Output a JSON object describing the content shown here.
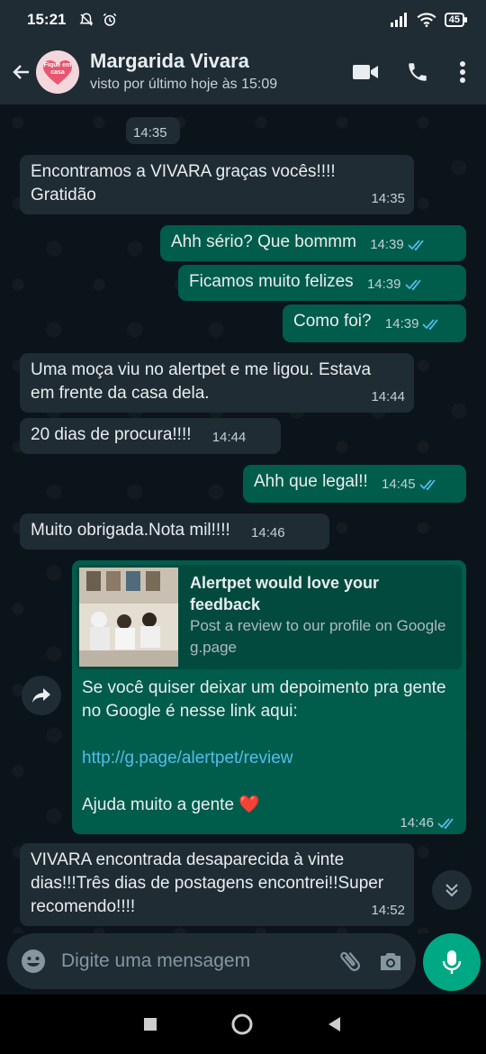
{
  "status_bar": {
    "time": "15:21",
    "battery": "45"
  },
  "header": {
    "contact_name": "Margarida Vivara",
    "last_seen": "visto por último hoje às 15:09",
    "avatar_text": "Fique em casa"
  },
  "messages": [
    {
      "type": "in",
      "text": "",
      "time": "14:35"
    },
    {
      "type": "in",
      "text": "Encontramos   a VIVARA  graças vocês!!!! Gratidão",
      "time": "14:35"
    },
    {
      "type": "out",
      "text": "Ahh sério? Que bommm",
      "time": "14:39"
    },
    {
      "type": "out",
      "text": "Ficamos muito felizes",
      "time": "14:39"
    },
    {
      "type": "out",
      "text": "Como foi?",
      "time": "14:39"
    },
    {
      "type": "in",
      "text": "Uma moça  viu no alertpet  e me ligou. Estava em frente da casa dela.",
      "time": "14:44"
    },
    {
      "type": "in",
      "text": "20 dias de procura!!!!",
      "time": "14:44"
    },
    {
      "type": "out",
      "text": "Ahh que legal!!",
      "time": "14:45"
    },
    {
      "type": "in",
      "text": "Muito obrigada.Nota mil!!!!",
      "time": "14:46"
    },
    {
      "type": "out-link",
      "preview_title": "Alertpet would love your feedback",
      "preview_desc": "Post a review to our profile on Google",
      "preview_domain": "g.page",
      "text": "Se você quiser deixar um depoimento pra gente no Google é nesse link aqui:",
      "url": "http://g.page/alertpet/review",
      "text2": "Ajuda muito a gente ❤️",
      "time": "14:46"
    },
    {
      "type": "in",
      "text": "VIVARA  encontrada  desaparecida  à vinte dias!!!Três  dias de postagens encontrei!!Super recomendo!!!!",
      "time": "14:52"
    }
  ],
  "input": {
    "placeholder": "Digite uma mensagem"
  },
  "icons": {
    "back": "arrow-left-icon",
    "video": "video-call-icon",
    "phone": "phone-icon",
    "menu": "more-vert-icon",
    "emoji": "emoji-icon",
    "attach": "paperclip-icon",
    "camera": "camera-icon",
    "mic": "mic-icon",
    "forward": "forward-icon",
    "scroll": "chevrons-down-icon"
  },
  "colors": {
    "incoming": "#1f2c34",
    "outgoing": "#005c4b",
    "accent": "#00a884",
    "tick_read": "#53bdeb"
  }
}
